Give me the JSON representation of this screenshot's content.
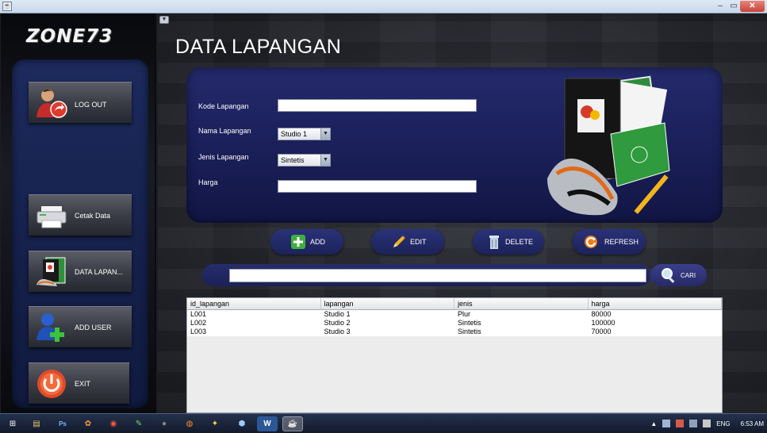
{
  "window": {
    "minimize_glyph": "–",
    "maximize_glyph": "▭",
    "close_glyph": "✕",
    "icon_glyph": "☕"
  },
  "sidebar": {
    "logo": "ZONE73",
    "items": [
      {
        "label": "LOG OUT",
        "icon": "user-logout-icon"
      },
      {
        "label": "Cetak Data",
        "icon": "printer-icon"
      },
      {
        "label": "DATA LAPAN...",
        "icon": "football-data-icon"
      },
      {
        "label": "ADD USER",
        "icon": "add-user-icon"
      },
      {
        "label": "EXIT",
        "icon": "power-icon"
      }
    ]
  },
  "main": {
    "collapse_glyph": "▼",
    "title": "DATA LAPANGAN",
    "form": {
      "kode_label": "Kode Lapangan",
      "kode_value": "",
      "nama_label": "Nama Lapangan",
      "nama_selected": "Studio 1",
      "jenis_label": "Jenis Lapangan",
      "jenis_selected": "Sintetis",
      "harga_label": "Harga",
      "harga_value": ""
    },
    "actions": {
      "add": "ADD",
      "edit": "EDIT",
      "delete": "DELETE",
      "refresh": "REFRESH"
    },
    "search": {
      "value": "",
      "button_label": "CARI"
    },
    "table": {
      "columns": [
        "id_lapangan",
        "lapangan",
        "jenis",
        "harga"
      ],
      "rows": [
        [
          "L001",
          "Studio 1",
          "Plur",
          "80000"
        ],
        [
          "L002",
          "Studio 2",
          "Sintetis",
          "100000"
        ],
        [
          "L003",
          "Studio 3",
          "Sintetis",
          "70000"
        ]
      ]
    }
  },
  "taskbar": {
    "language": "ENG",
    "clock": "6:53 AM",
    "apps": [
      {
        "icon": "windows-start-icon",
        "glyph": "⊞"
      },
      {
        "icon": "file-explorer-icon",
        "glyph": "▤"
      },
      {
        "icon": "photoshop-icon",
        "glyph": "Ps"
      },
      {
        "icon": "app-orange-icon",
        "glyph": "✿"
      },
      {
        "icon": "app-red-icon",
        "glyph": "◉"
      },
      {
        "icon": "app-green-icon",
        "glyph": "✎"
      },
      {
        "icon": "app-dark-icon",
        "glyph": "●"
      },
      {
        "icon": "firefox-icon",
        "glyph": "◍"
      },
      {
        "icon": "paint-icon",
        "glyph": "✦"
      },
      {
        "icon": "app-box-icon",
        "glyph": "⬢"
      },
      {
        "icon": "word-icon",
        "glyph": "W"
      },
      {
        "icon": "java-app-icon",
        "glyph": "☕"
      }
    ]
  },
  "colors": {
    "panel": "#1c2259",
    "accent_green": "#3fae3f",
    "accent_orange": "#f07a1a"
  }
}
